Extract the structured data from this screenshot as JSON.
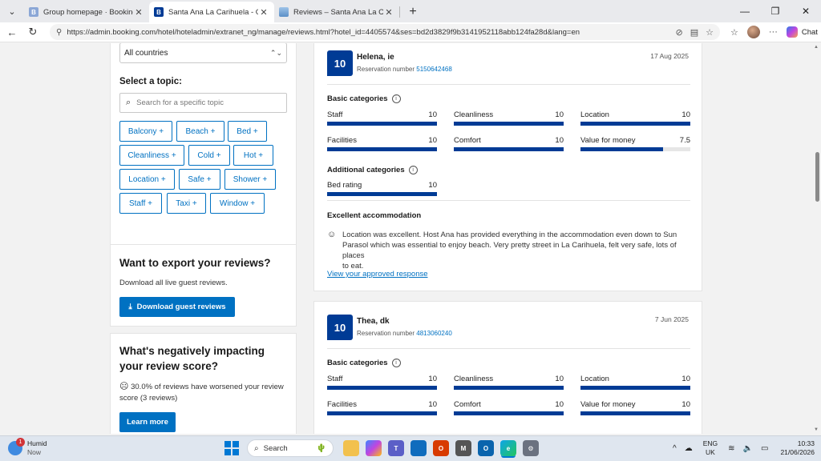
{
  "browser": {
    "tabs": [
      {
        "title": "Group homepage · Booking.com",
        "favicon_color": "#8ba7d6",
        "favicon_letter": "B",
        "active": false
      },
      {
        "title": "Santa Ana La Carihuela - Guest reviews",
        "favicon_color": "#003b95",
        "favicon_letter": "B",
        "active": true
      },
      {
        "title": "Reviews – Santa Ana La Carihuela",
        "favicon_color": "#5b8fc7",
        "favicon_letter": "",
        "active": false
      }
    ],
    "url": "https://admin.booking.com/hotel/hoteladmin/extranet_ng/manage/reviews.html?hotel_id=4405574&ses=bd2d3829f9b3141952118abb124fa28d&lang=en",
    "chat_label": "Chat"
  },
  "filters": {
    "country_value": "All countries",
    "topic_heading": "Select a topic:",
    "topic_placeholder": "Search for a specific topic",
    "topics": [
      "Balcony +",
      "Beach +",
      "Bed +",
      "Cleanliness +",
      "Cold +",
      "Hot +",
      "Location +",
      "Safe +",
      "Shower +",
      "Staff +",
      "Taxi +",
      "Window +"
    ]
  },
  "export": {
    "heading": "Want to export your reviews?",
    "body": "Download all live guest reviews.",
    "button": "Download guest reviews"
  },
  "negative": {
    "heading_line1": "What's negatively impacting",
    "heading_line2": "your review score?",
    "body_line1": "30.0% of reviews have worsened your review",
    "body_line2": "score (3 reviews)",
    "button": "Learn more"
  },
  "reviews": [
    {
      "score": "10",
      "name": "Helena, ie",
      "reservation_label": "Reservation number",
      "reservation_number": "5150642468",
      "date": "17 Aug 2025",
      "basic_heading": "Basic categories",
      "basic": [
        {
          "label": "Staff",
          "value": "10",
          "fraction": 1.0
        },
        {
          "label": "Cleanliness",
          "value": "10",
          "fraction": 1.0
        },
        {
          "label": "Location",
          "value": "10",
          "fraction": 1.0
        },
        {
          "label": "Facilities",
          "value": "10",
          "fraction": 1.0
        },
        {
          "label": "Comfort",
          "value": "10",
          "fraction": 1.0
        },
        {
          "label": "Value for money",
          "value": "7.5",
          "fraction": 0.75
        }
      ],
      "additional_heading": "Additional categories",
      "additional": [
        {
          "label": "Bed rating",
          "value": "10",
          "fraction": 1.0
        }
      ],
      "title": "Excellent accommodation",
      "text_line1": "Location was excellent. Host Ana has provided everything in the accommodation even down to Sun",
      "text_line2": "Parasol which was essential to enjoy beach. Very pretty street in La Carihuela, felt very safe, lots of places",
      "text_line3": "to eat.",
      "response_link": "View your approved response"
    },
    {
      "score": "10",
      "name": "Thea, dk",
      "reservation_label": "Reservation number",
      "reservation_number": "4813060240",
      "date": "7 Jun 2025",
      "basic_heading": "Basic categories",
      "basic": [
        {
          "label": "Staff",
          "value": "10",
          "fraction": 1.0
        },
        {
          "label": "Cleanliness",
          "value": "10",
          "fraction": 1.0
        },
        {
          "label": "Location",
          "value": "10",
          "fraction": 1.0
        },
        {
          "label": "Facilities",
          "value": "10",
          "fraction": 1.0
        },
        {
          "label": "Comfort",
          "value": "10",
          "fraction": 1.0
        },
        {
          "label": "Value for money",
          "value": "10",
          "fraction": 1.0
        }
      ]
    }
  ],
  "taskbar": {
    "weather_title": "Humid",
    "weather_sub": "Now",
    "weather_badge": "1",
    "search_label": "Search",
    "lang_line1": "ENG",
    "lang_line2": "UK",
    "time": "10:33",
    "date": "21/06/2026"
  }
}
